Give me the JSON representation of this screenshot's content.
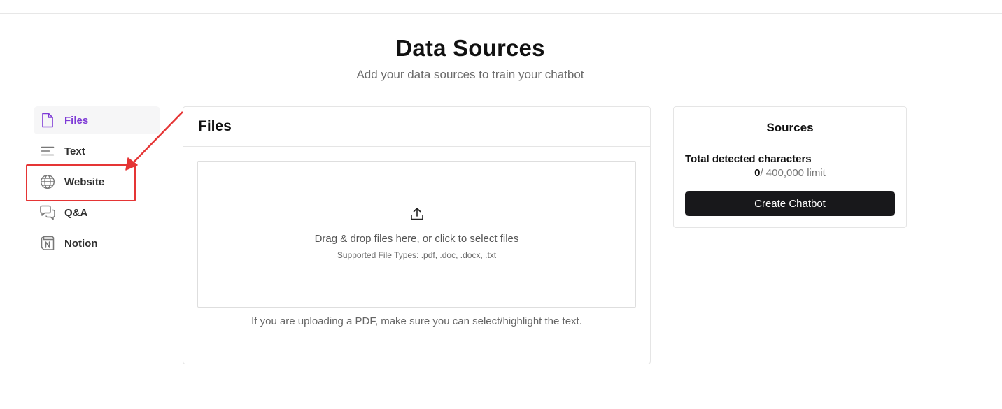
{
  "header": {
    "title": "Data Sources",
    "subtitle": "Add your data sources to train your chatbot"
  },
  "sidebar": {
    "items": [
      {
        "label": "Files",
        "icon": "file-icon",
        "active": true
      },
      {
        "label": "Text",
        "icon": "text-lines-icon",
        "active": false
      },
      {
        "label": "Website",
        "icon": "globe-icon",
        "active": false
      },
      {
        "label": "Q&A",
        "icon": "chat-bubbles-icon",
        "active": false
      },
      {
        "label": "Notion",
        "icon": "notion-icon",
        "active": false
      }
    ]
  },
  "files_panel": {
    "title": "Files",
    "dropzone_text": "Drag & drop files here, or click to select files",
    "supported_types": "Supported File Types: .pdf, .doc, .docx, .txt",
    "pdf_note": "If you are uploading a PDF, make sure you can select/highlight the text.",
    "icon": "upload-icon"
  },
  "sources_panel": {
    "title": "Sources",
    "total_label": "Total detected characters",
    "count": "0",
    "limit": "/ 400,000 limit",
    "create_button": "Create Chatbot"
  },
  "colors": {
    "accent": "#7e3ad6",
    "annotation": "#e53535",
    "button_bg": "#18181b"
  }
}
